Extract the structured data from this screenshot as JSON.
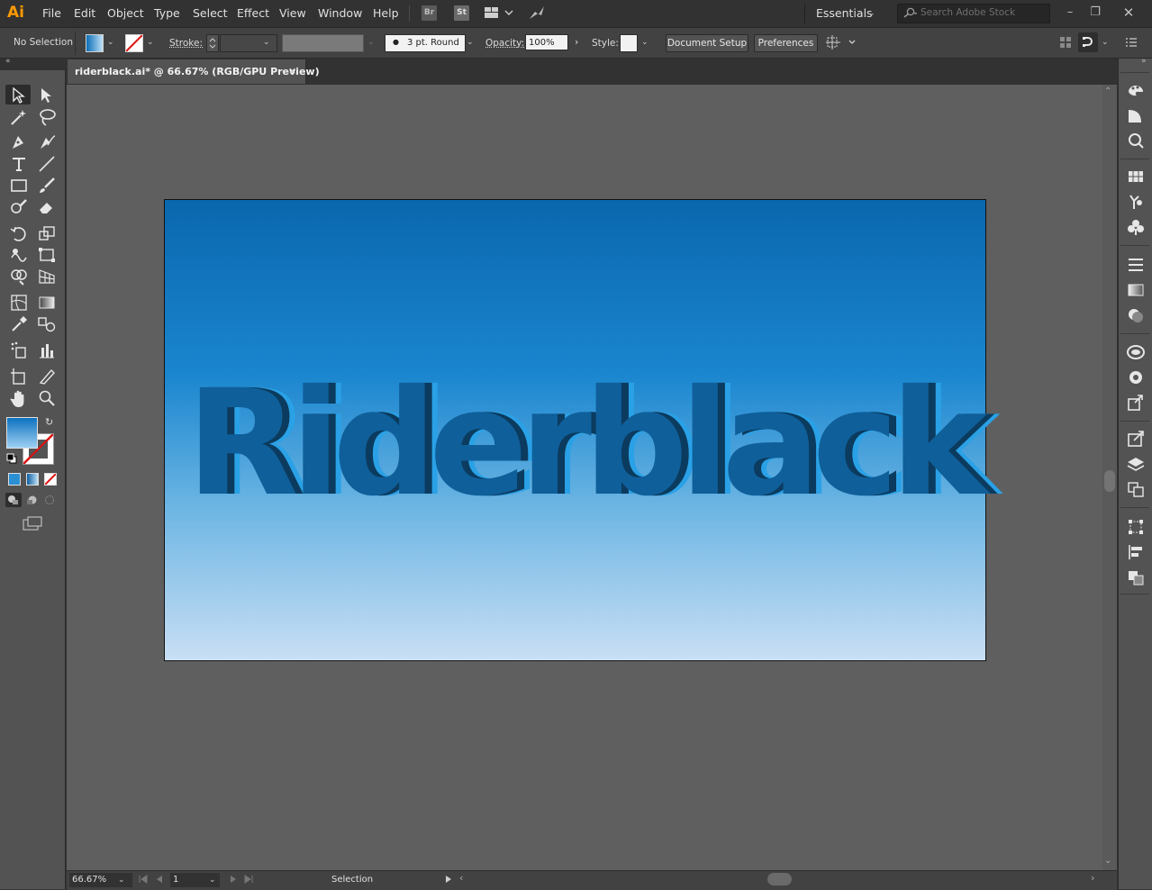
{
  "app": {
    "logo": "Ai",
    "colors": {
      "accent": "#ff9a00",
      "chrome": "#535353",
      "canvas": "#5f5f5f"
    }
  },
  "menubar": {
    "items": [
      "File",
      "Edit",
      "Object",
      "Type",
      "Select",
      "Effect",
      "View",
      "Window",
      "Help"
    ],
    "bridge": "Br",
    "stock": "St",
    "workspace": "Essentials",
    "search_placeholder": "Search Adobe Stock"
  },
  "control": {
    "selection": "No Selection",
    "stroke_label": "Stroke:",
    "brush": "3 pt. Round",
    "opacity_label": "Opacity:",
    "opacity_value": "100%",
    "style_label": "Style:",
    "doc_setup": "Document Setup",
    "preferences": "Preferences"
  },
  "document": {
    "tab_title": "riderblack.ai* @ 66.67% (RGB/GPU Preview)",
    "close": "×",
    "artwork_text": "Riderblack"
  },
  "status": {
    "zoom": "66.67%",
    "page": "1",
    "tool": "Selection"
  }
}
